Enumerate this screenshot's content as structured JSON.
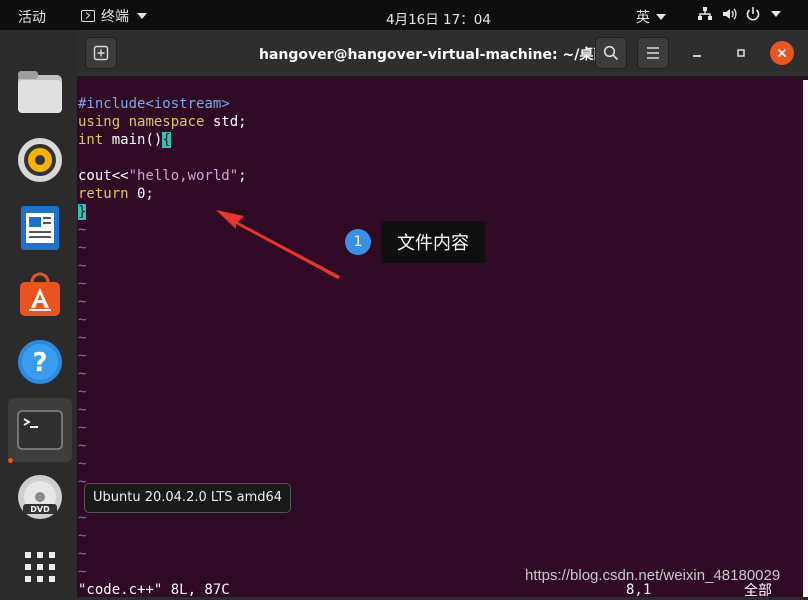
{
  "topbar": {
    "activities": "活动",
    "app_name": "终端",
    "clock": "4月16日 17：04",
    "ime": "英"
  },
  "window": {
    "title": "hangover@hangover-virtual-machine: ~/桌面"
  },
  "editor": {
    "lines": {
      "l1_pp": "#include",
      "l1_rest": "<iostream>",
      "l2_kw1": "using",
      "l2_kw2": "namespace",
      "l2_rest": " std;",
      "l3_kw": "int",
      "l3_rest": " main()",
      "l3_cursor": "{",
      "l5_a": "cout<<",
      "l5_str": "\"hello,world\"",
      "l5_b": ";",
      "l6_kw": "return",
      "l6_rest": " 0;",
      "l7": "}"
    },
    "tilde": "~",
    "status_file": "\"code.c++\" 8L, 87C",
    "status_pos": "8,1",
    "status_all": "全部"
  },
  "annotation": {
    "number": "1",
    "label": "文件内容"
  },
  "tooltip": "Ubuntu 20.04.2.0 LTS amd64",
  "watermark": "https://blog.csdn.net/weixin_48180029",
  "colors": {
    "terminal_bg": "#300a24",
    "accent_close": "#e95420",
    "callout_blue": "#3a8fe6",
    "arrow_red": "#e8352e"
  }
}
